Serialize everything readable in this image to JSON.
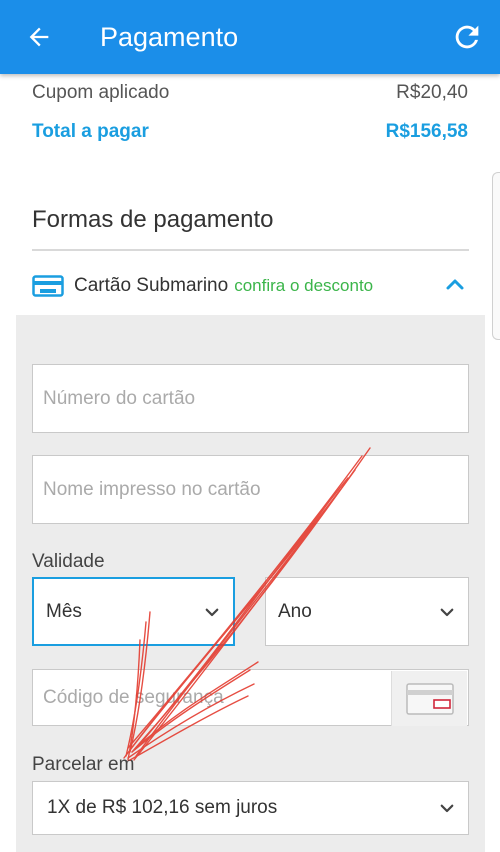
{
  "header": {
    "title": "Pagamento",
    "back_icon": "arrow-left-icon",
    "refresh_icon": "refresh-icon",
    "background": "#1b8ee9"
  },
  "summary": {
    "coupon_label": "Cupom aplicado",
    "coupon_value": "R$20,40",
    "total_label": "Total a pagar",
    "total_value": "R$156,58",
    "accent": "#1a9ee0"
  },
  "payment": {
    "section_title": "Formas de pagamento",
    "method_label": "Cartão Submarino",
    "method_promo": "confira o desconto",
    "promo_color": "#3bb54a",
    "card_number_placeholder": "Número do cartão",
    "card_name_placeholder": "Nome impresso no cartão",
    "validity_label": "Validade",
    "month_value": "Mês",
    "year_value": "Ano",
    "cvv_placeholder": "Código de segurança",
    "installments_label": "Parcelar em",
    "installments_value": "1X de R$ 102,16 sem juros"
  }
}
